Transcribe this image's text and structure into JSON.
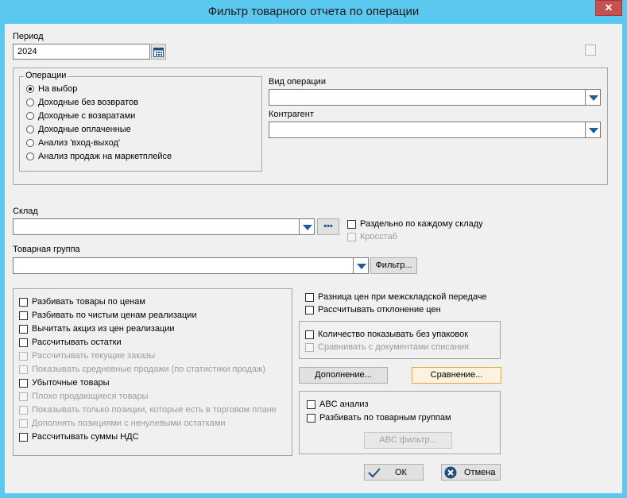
{
  "window": {
    "title": "Фильтр товарного отчета по операции",
    "close": "✕"
  },
  "period": {
    "label": "Период",
    "value": "2024"
  },
  "operations": {
    "legend": "Операции",
    "options": [
      {
        "label": "На выбор",
        "selected": true
      },
      {
        "label": "Доходные без возвратов",
        "selected": false
      },
      {
        "label": "Доходные с возвратами",
        "selected": false
      },
      {
        "label": "Доходные оплаченные",
        "selected": false
      },
      {
        "label": "Анализ 'вход-выход'",
        "selected": false
      },
      {
        "label": "Анализ продаж на маркетплейсе",
        "selected": false
      }
    ]
  },
  "op_type": {
    "label": "Вид операции",
    "value": ""
  },
  "counterparty": {
    "label": "Контрагент",
    "value": ""
  },
  "warehouse": {
    "label": "Склад",
    "value": "",
    "browse": "•••",
    "split_label": "Раздельно по каждому складу",
    "crosstab_label": "Кросстаб"
  },
  "product_group": {
    "label": "Товарная группа",
    "value": "",
    "filter_button": "Фильтр..."
  },
  "left_options": [
    {
      "label": "Разбивать товары по ценам",
      "enabled": true
    },
    {
      "label": "Разбивать по чистым ценам реализации",
      "enabled": true
    },
    {
      "label": "Вычитать акциз из цен реализации",
      "enabled": true
    },
    {
      "label": "Рассчитывать остатки",
      "enabled": true
    },
    {
      "label": "Рассчитывать текущие заказы",
      "enabled": false
    },
    {
      "label": "Показывать средневные продажи (по статистики продаж)",
      "enabled": false
    },
    {
      "label": "Убыточные товары",
      "enabled": true
    },
    {
      "label": "Плохо продающиеся товары",
      "enabled": false
    },
    {
      "label": "Показывать только позиции, которые есть в торговом плане",
      "enabled": false
    },
    {
      "label": "Дополнять позициями с ненулевыми остатками",
      "enabled": false
    },
    {
      "label": "Рассчитывать суммы НДС",
      "enabled": true
    }
  ],
  "right_options": {
    "price_diff": "Разница цен при межскладской передаче",
    "calc_deviation": "Рассчитывать отклонение цен",
    "qty_no_pack": "Количество показывать без упаковок",
    "compare_writeoff": "Сравнивать с документами списания"
  },
  "buttons": {
    "addition": "Дополнение...",
    "comparison": "Сравнение...",
    "abc_filter": "ABC фильтр...",
    "ok": "ОК",
    "cancel": "Отмена"
  },
  "abc": {
    "analysis": "ABC анализ",
    "by_groups": "Разбивать по товарным группам"
  },
  "colors": {
    "titlebar": "#5ac8ef",
    "close": "#c75050",
    "combo_arrow": "#1f5c9a"
  }
}
